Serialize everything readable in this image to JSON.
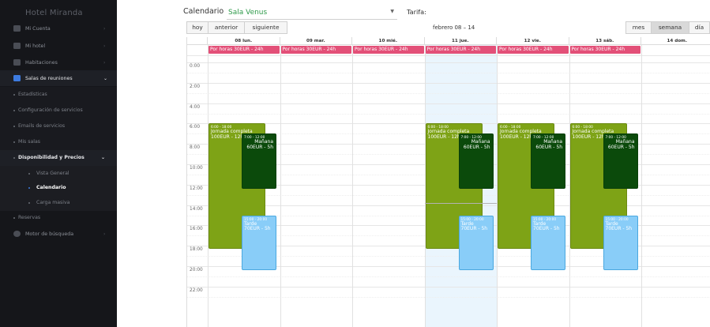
{
  "sidebar": {
    "brand": "Hotel Miranda",
    "items": [
      {
        "label": "Mi Cuenta"
      },
      {
        "label": "Mi hotel"
      },
      {
        "label": "Habitaciones"
      },
      {
        "label": "Salas de reuniones"
      }
    ],
    "sub_items": [
      {
        "label": "Estadísticas"
      },
      {
        "label": "Configuración de servicios"
      },
      {
        "label": "Emails de servicios"
      },
      {
        "label": "Mis salas"
      },
      {
        "label": "Disponibilidad y Precios"
      }
    ],
    "sub_sub_items": [
      {
        "label": "Vista General"
      },
      {
        "label": "Calendario"
      },
      {
        "label": "Carga masiva"
      }
    ],
    "bottom_items": [
      {
        "label": "Reservas"
      },
      {
        "label": "Motor de búsqueda"
      }
    ],
    "chevron_right": "›",
    "chevron_down": "⌄"
  },
  "header": {
    "calendar_label": "Calendario",
    "venue_value": "Sala Venus",
    "tarifa_label": "Tarifa:"
  },
  "toolbar": {
    "today": "hoy",
    "prev": "anterior",
    "next": "siguiente",
    "range_title": "febrero 08 – 14",
    "views": [
      "mes",
      "semana",
      "día"
    ],
    "active_view": "semana"
  },
  "calendar": {
    "days": [
      "08 lun.",
      "09 mar.",
      "10 mié.",
      "11 jue.",
      "12 vie.",
      "13 sáb.",
      "14 dom."
    ],
    "hours": [
      "0:00",
      "2:00",
      "4:00",
      "6:00",
      "8:00",
      "10:00",
      "12:00",
      "14:00",
      "16:00",
      "18:00",
      "20:00",
      "22:00"
    ],
    "allday_label": "Por horas 30EUR - 24h",
    "event_full_time": "6:00 - 18:00",
    "event_full_title": "Jornada completa",
    "event_full_price": "100EUR - 12h",
    "event_morning_time": "7:00 - 12:00",
    "event_morning_title": "Mañana",
    "event_morning_price": "60EUR - 5h",
    "event_afternoon_time": "15:00 - 20:00",
    "event_afternoon_title": "Tarde",
    "event_afternoon_price": "70EUR - 5h"
  },
  "colors": {
    "accent": "#3d7be0",
    "allday": "#e35078",
    "full_day": "#7ea316",
    "morning": "#0b4a0b",
    "afternoon": "#89cdf8",
    "today_bg": "#eaf5fd",
    "venue_green": "#2e9a4a"
  }
}
